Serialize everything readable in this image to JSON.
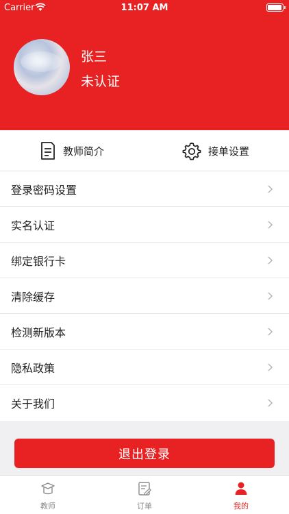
{
  "status_bar": {
    "carrier": "Carrier",
    "time": "11:07 AM"
  },
  "profile": {
    "name": "张三",
    "status": "未认证"
  },
  "quick_actions": [
    {
      "label": "教师简介",
      "icon": "document-icon"
    },
    {
      "label": "接单设置",
      "icon": "gear-icon"
    }
  ],
  "menu": [
    {
      "label": "登录密码设置"
    },
    {
      "label": "实名认证"
    },
    {
      "label": "绑定银行卡"
    },
    {
      "label": "清除缓存"
    },
    {
      "label": "检测新版本"
    },
    {
      "label": "隐私政策"
    },
    {
      "label": "关于我们"
    }
  ],
  "logout_label": "退出登录",
  "tabs": [
    {
      "label": "教师",
      "icon": "graduation-cap-icon",
      "active": false
    },
    {
      "label": "订单",
      "icon": "order-note-icon",
      "active": false
    },
    {
      "label": "我的",
      "icon": "person-icon",
      "active": true
    }
  ],
  "colors": {
    "primary": "#e82222",
    "background": "#f0f0f2",
    "inactive": "#8a8a8a"
  }
}
